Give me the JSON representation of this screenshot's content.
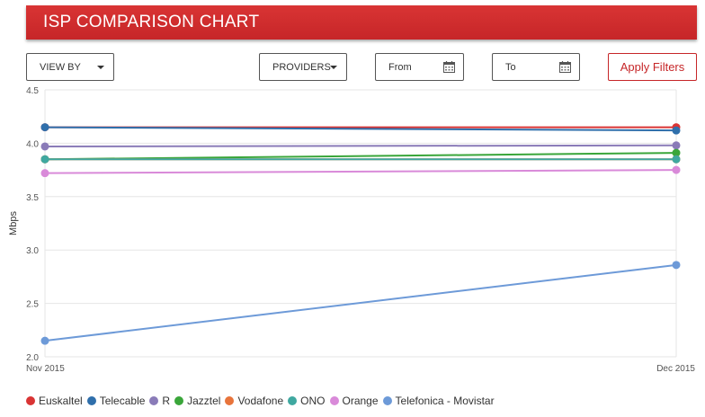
{
  "header": {
    "title": "ISP COMPARISON CHART"
  },
  "filters": {
    "view_by_label": "VIEW BY",
    "providers_label": "PROVIDERS",
    "from_label": "From",
    "to_label": "To",
    "apply_label": "Apply Filters"
  },
  "colors": {
    "accent": "#c62628"
  },
  "chart_data": {
    "type": "line",
    "x": [
      "Nov 2015",
      "Dec 2015"
    ],
    "ylabel": "Mbps",
    "ylim": [
      2.0,
      4.5
    ],
    "yticks": [
      "2.0",
      "2.5",
      "3.0",
      "3.5",
      "4.0",
      "4.5"
    ],
    "grid": "horizontal",
    "legend_position": "bottom",
    "series": [
      {
        "name": "Euskaltel",
        "color": "#d93434",
        "values": [
          4.15,
          4.15
        ]
      },
      {
        "name": "Telecable",
        "color": "#2f6fab",
        "values": [
          4.15,
          4.12
        ]
      },
      {
        "name": "R",
        "color": "#8a7bb8",
        "values": [
          3.97,
          3.98
        ]
      },
      {
        "name": "Jazztel",
        "color": "#3aa63a",
        "values": [
          3.85,
          3.91
        ]
      },
      {
        "name": "Vodafone",
        "color": "#e8743b",
        "values": [
          3.85,
          3.85
        ]
      },
      {
        "name": "ONO",
        "color": "#3fa8a0",
        "values": [
          3.85,
          3.85
        ]
      },
      {
        "name": "Orange",
        "color": "#d98ad9",
        "values": [
          3.72,
          3.75
        ]
      },
      {
        "name": "Telefonica - Movistar",
        "color": "#6d9ad8",
        "values": [
          2.15,
          2.86
        ]
      }
    ]
  }
}
